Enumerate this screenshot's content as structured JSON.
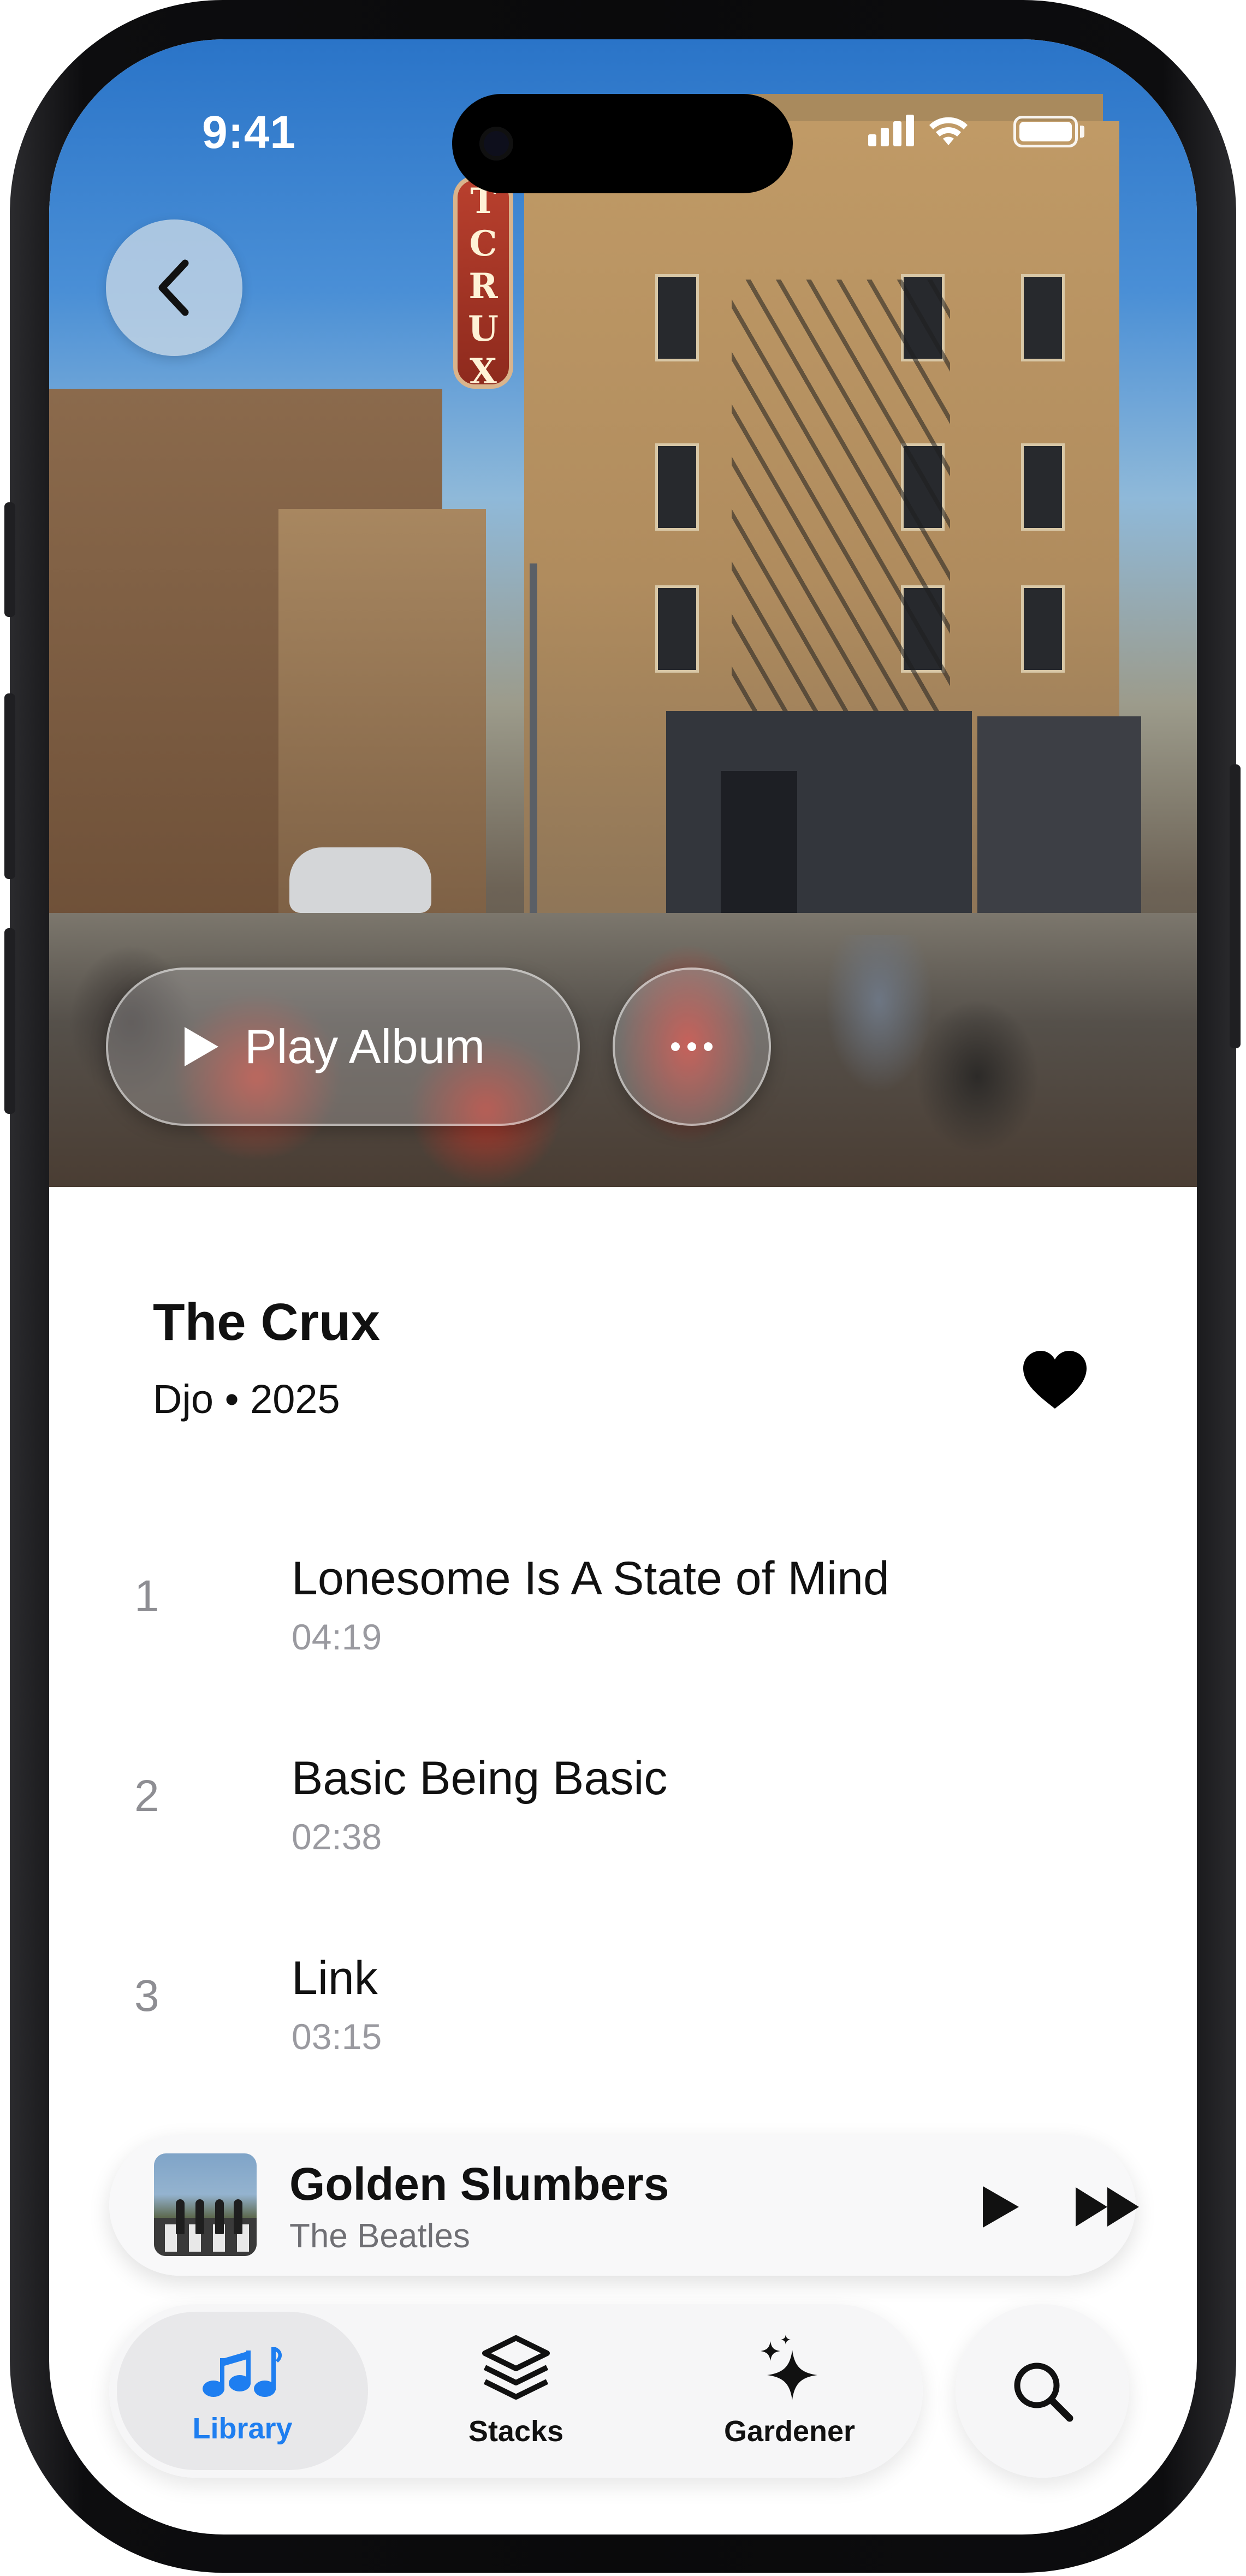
{
  "status_bar": {
    "time": "9:41"
  },
  "hero": {
    "sign_text": "THE CRUX",
    "back_icon": "chevron-left-icon",
    "play_album_label": "Play Album",
    "more_icon": "ellipsis-icon"
  },
  "album": {
    "title": "The Crux",
    "meta": "Djo • 2025",
    "favorite_icon": "heart-icon"
  },
  "tracks": [
    {
      "number": "1",
      "title": "Lonesome Is A State of Mind",
      "duration": "04:19"
    },
    {
      "number": "2",
      "title": "Basic Being Basic",
      "duration": "02:38"
    },
    {
      "number": "3",
      "title": "Link",
      "duration": "03:15"
    }
  ],
  "now_playing": {
    "title": "Golden Slumbers",
    "artist": "The Beatles",
    "play_icon": "play-icon",
    "forward_icon": "fast-forward-icon"
  },
  "tab_bar": {
    "tabs": [
      {
        "label": "Library",
        "icon": "music-notes-icon",
        "active": true
      },
      {
        "label": "Stacks",
        "icon": "stack-icon",
        "active": false
      },
      {
        "label": "Gardener",
        "icon": "sparkles-icon",
        "active": false
      }
    ],
    "search_icon": "search-icon"
  },
  "colors": {
    "accent": "#1e7ef0",
    "text_primary": "#111111",
    "text_secondary": "#8e8e93"
  }
}
